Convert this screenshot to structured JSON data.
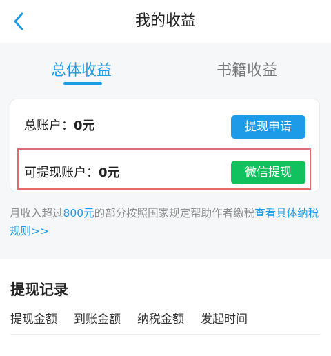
{
  "header": {
    "title": "我的收益"
  },
  "tabs": [
    {
      "label": "总体收益"
    },
    {
      "label": "书籍收益"
    }
  ],
  "accounts": {
    "total": {
      "label": "总账户：",
      "value": "0元",
      "button": "提现申请"
    },
    "withdrawable": {
      "label": "可提现账户：",
      "value": "0元",
      "button": "微信提现"
    }
  },
  "tax_note": {
    "prefix": "月收入超过",
    "amount": "800元",
    "middle": "的部分按照国家规定帮助作者缴税",
    "link": "查看具体纳税规则>>"
  },
  "records": {
    "title": "提现记录",
    "columns": [
      "提现金额",
      "到账金额",
      "纳税金额",
      "发起时间"
    ]
  },
  "colors": {
    "accent": "#1e9be8",
    "wechat_green": "#11c15d",
    "highlight_red": "#e26b6b"
  }
}
